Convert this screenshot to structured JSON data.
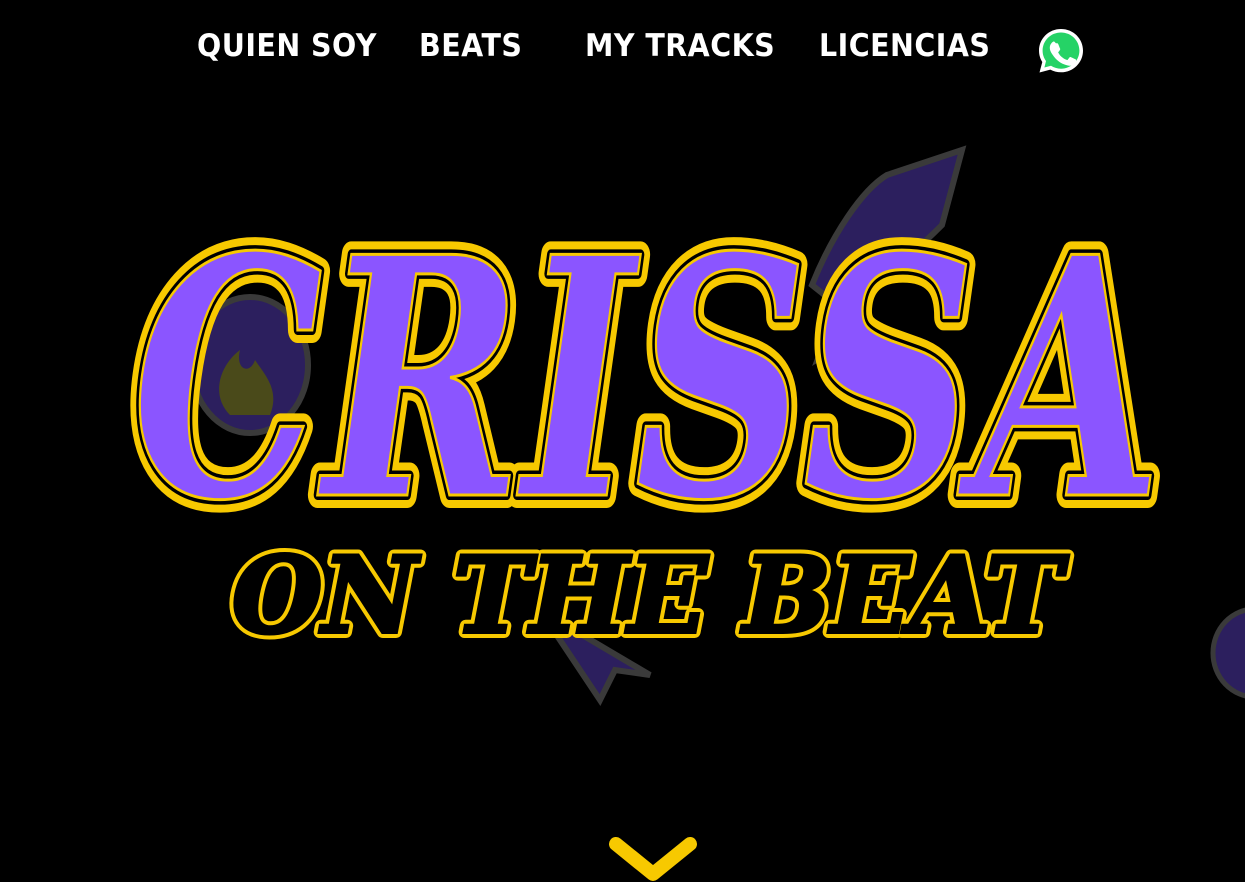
{
  "nav": {
    "items": [
      {
        "label": "QUIEN SOY"
      },
      {
        "label": "BEATS"
      },
      {
        "label": "MY TRACKS"
      },
      {
        "label": "LICENCIAS"
      }
    ],
    "whatsapp_icon": "whatsapp-icon"
  },
  "hero": {
    "logo_title": "CRISSA",
    "logo_subtitle": "ON THE BEAT"
  },
  "scroll_icon": "chevron-down-icon",
  "colors": {
    "background": "#000000",
    "nav_text": "#ffffff",
    "logo_fill": "#8b55ff",
    "logo_outline": "#f7c900",
    "whatsapp_green": "#25d366",
    "sticker_gray": "#3a3a3a",
    "sticker_purple": "#2c1f5e"
  }
}
